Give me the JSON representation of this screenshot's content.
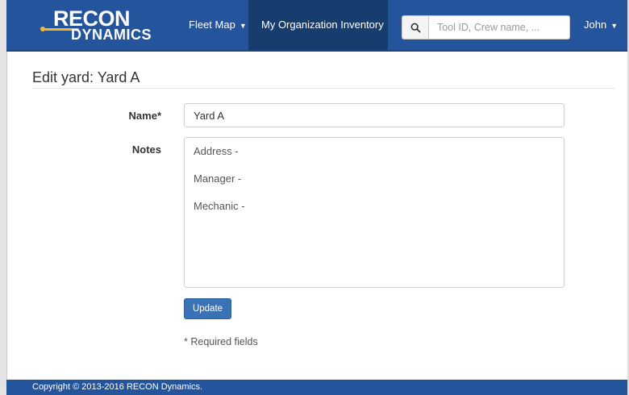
{
  "brand": {
    "line1": "RECON",
    "line2": "DYNAMICS"
  },
  "nav": {
    "fleet_map": "Fleet Map",
    "inventory": "My Organization Inventory",
    "user": "John",
    "search_placeholder": "Tool ID, Crew name, ..."
  },
  "page": {
    "title": "Edit yard: Yard A"
  },
  "form": {
    "name_label": "Name*",
    "name_value": "Yard A",
    "notes_label": "Notes",
    "notes_lines": [
      "Address -",
      "Manager -",
      "Mechanic -"
    ],
    "update_label": "Update",
    "required_note": "* Required fields"
  },
  "footer": {
    "copyright": "Copyright © 2013-2016 RECON Dynamics."
  },
  "colors": {
    "navbar": "#24549c",
    "active_nav": "#173d6e",
    "button": "#3a73b5",
    "logo_accent": "#f2b92e"
  }
}
